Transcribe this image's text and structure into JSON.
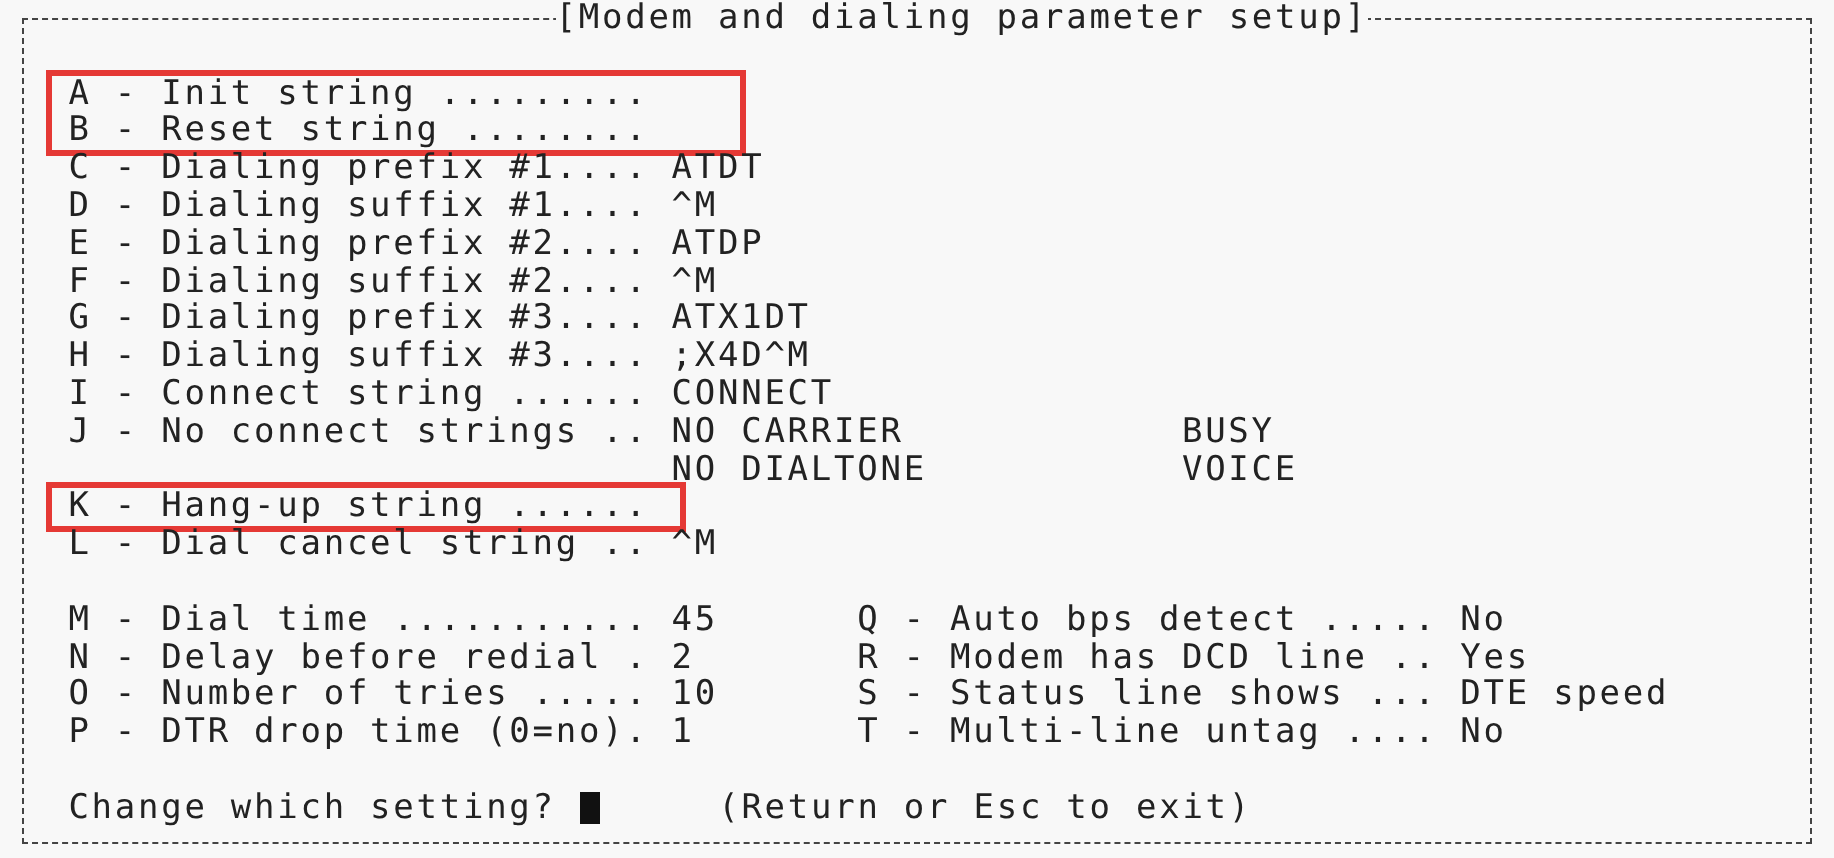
{
  "title": "[Modem and dialing parameter setup]",
  "settings": [
    {
      "label": "A - Init string .........",
      "highlighted": true
    },
    {
      "label": "B - Reset string ........",
      "highlighted": true
    },
    {
      "label": "C - Dialing prefix #1....",
      "value": "ATDT",
      "highlighted": false
    },
    {
      "label": "D - Dialing suffix #1....",
      "value": "^M",
      "highlighted": false
    },
    {
      "label": "E - Dialing prefix #2....",
      "value": "ATDP",
      "highlighted": false
    },
    {
      "label": "F - Dialing suffix #2....",
      "value": "^M",
      "highlighted": false
    },
    {
      "label": "G - Dialing prefix #3....",
      "value": "ATX1DT",
      "highlighted": false
    },
    {
      "label": "H - Dialing suffix #3....",
      "value": ";X4D^M",
      "highlighted": false
    },
    {
      "label": "I - Connect string ......",
      "value": "CONNECT",
      "highlighted": false
    },
    {
      "label": "J - No connect strings ..",
      "values": [
        "NO CARRIER",
        "BUSY",
        "NO DIALTONE",
        "VOICE"
      ],
      "highlighted": false
    },
    {
      "label": "K - Hang-up string ......",
      "highlighted": true
    },
    {
      "label": "L - Dial cancel string ..",
      "value": "^M",
      "highlighted": false
    }
  ],
  "left_options": [
    {
      "label": "M - Dial time ...........",
      "value": "45"
    },
    {
      "label": "N - Delay before redial .",
      "value": "2"
    },
    {
      "label": "O - Number of tries .....",
      "value": "10"
    },
    {
      "label": "P - DTR drop time (0=no).",
      "value": "1"
    }
  ],
  "right_options": [
    {
      "label": "Q - Auto bps detect .....",
      "value": "No"
    },
    {
      "label": "R - Modem has DCD line ..",
      "value": "Yes"
    },
    {
      "label": "S - Status line shows ...",
      "value": "DTE speed"
    },
    {
      "label": "T - Multi-line untag ....",
      "value": "No"
    }
  ],
  "prompt": {
    "text": "Change which setting?",
    "hint": "(Return or Esc to exit)"
  }
}
